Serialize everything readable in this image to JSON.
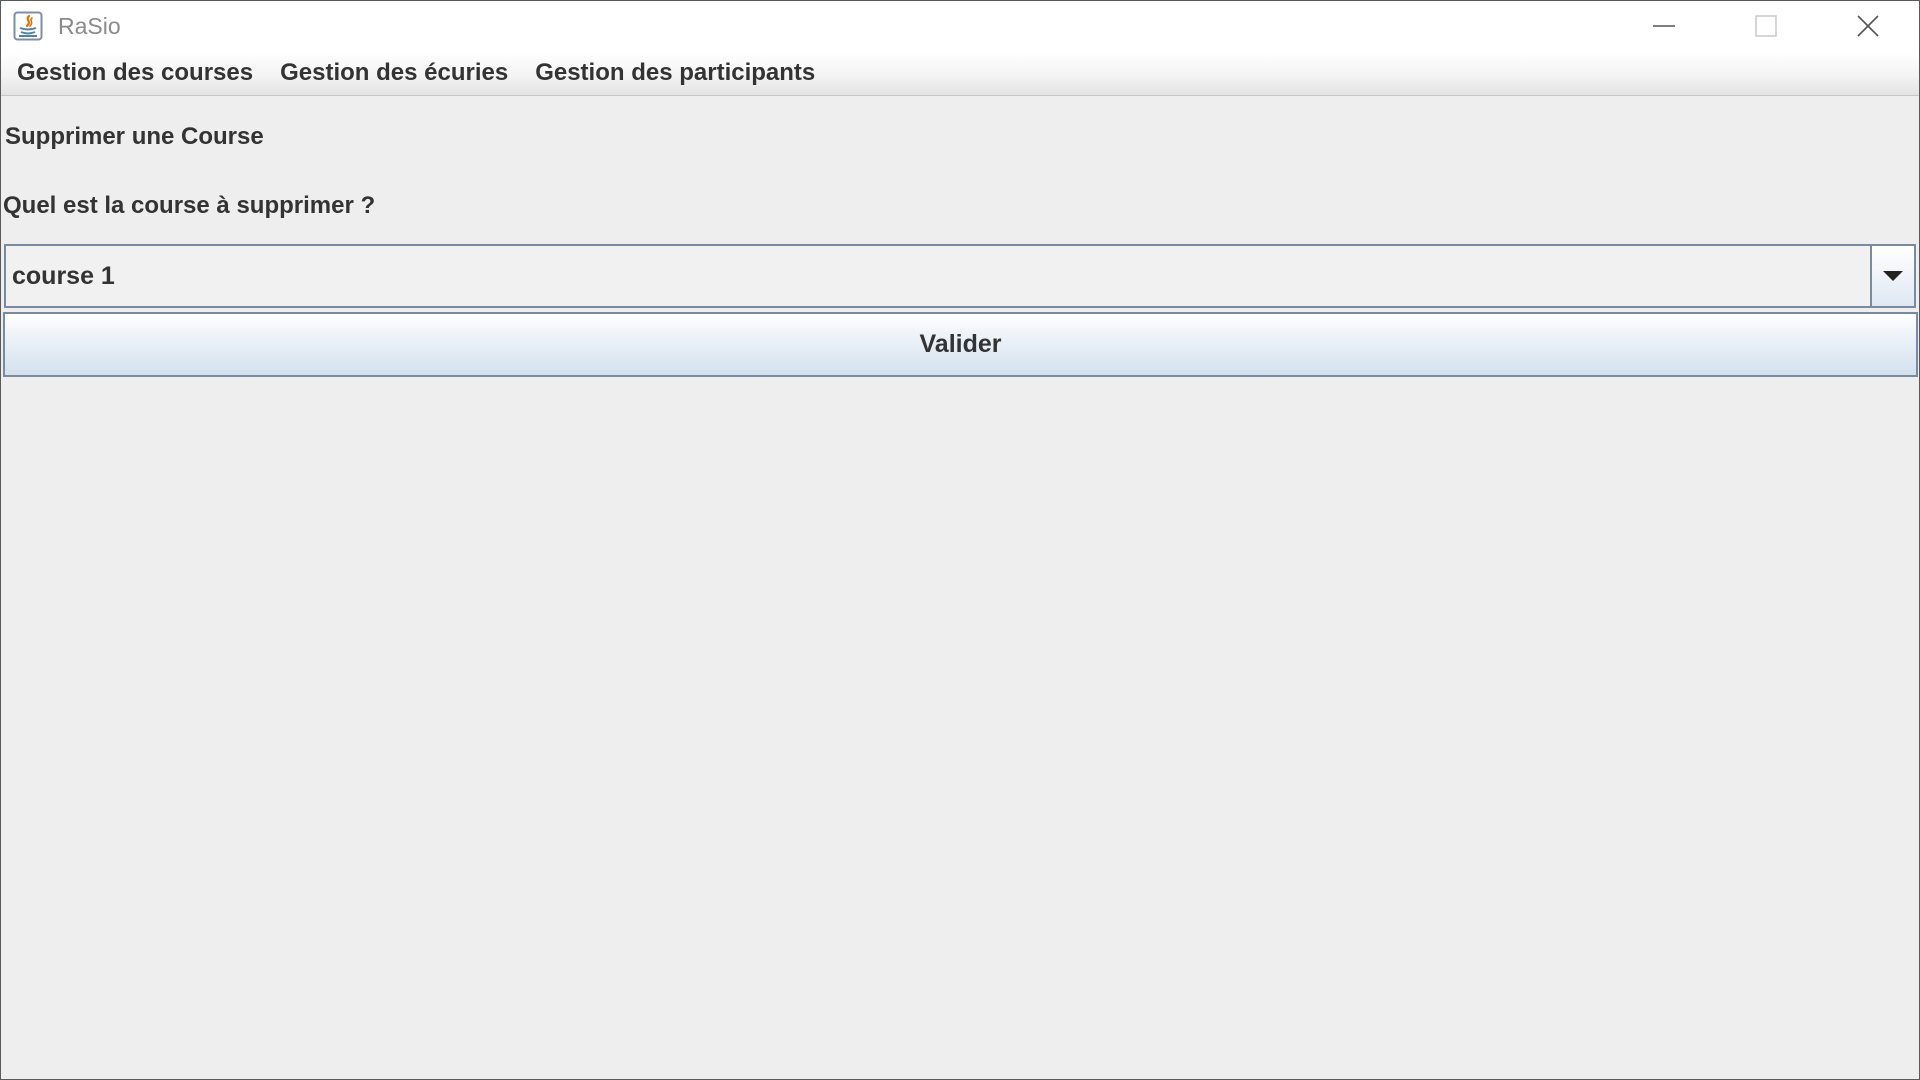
{
  "window": {
    "title": "RaSio"
  },
  "menubar": {
    "items": [
      {
        "label": "Gestion des courses"
      },
      {
        "label": "Gestion des écuries"
      },
      {
        "label": "Gestion des participants"
      }
    ]
  },
  "form": {
    "heading": "Supprimer une Course",
    "question": "Quel est la course à supprimer ?",
    "selected_course": "course 1",
    "submit_label": "Valider"
  },
  "icons": {
    "app": "java-icon",
    "minimize": "minimize-icon",
    "maximize": "maximize-icon",
    "close": "close-icon",
    "dropdown": "chevron-down-icon"
  },
  "colors": {
    "window_background": "#eeeeee",
    "text": "#333333",
    "control_border": "#7a8aa0"
  }
}
